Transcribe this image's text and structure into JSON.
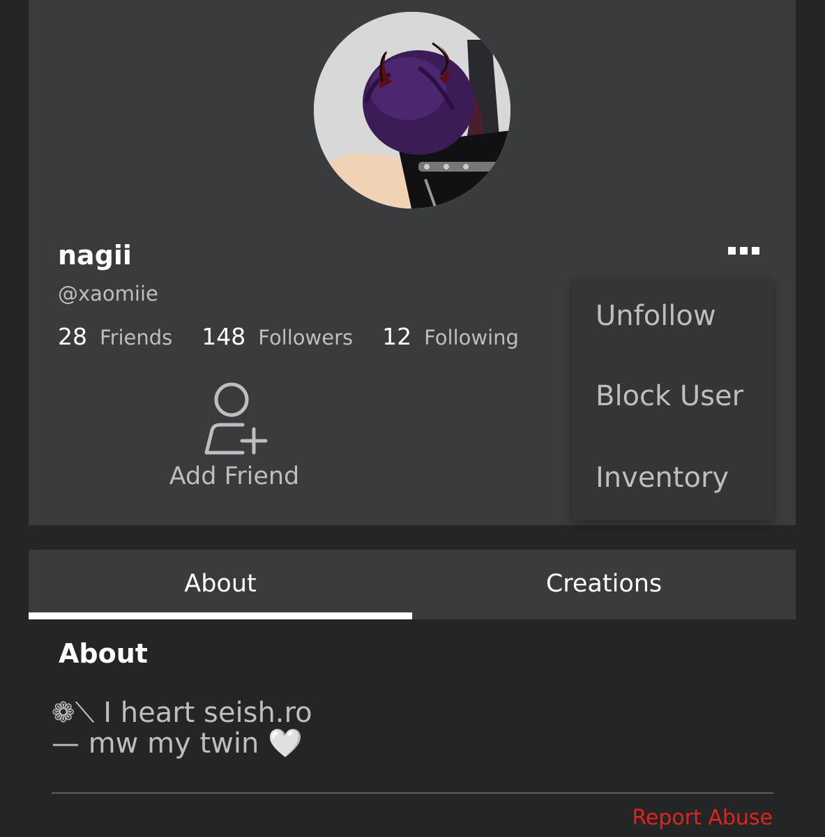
{
  "profile": {
    "display_name": "nagii",
    "username": "@xaomiie",
    "stats": [
      {
        "count": "28",
        "label": "Friends"
      },
      {
        "count": "148",
        "label": "Followers"
      },
      {
        "count": "12",
        "label": "Following"
      }
    ],
    "add_friend_label": "Add Friend",
    "avatar_icon": "avatar-headshot"
  },
  "menu": {
    "more_icon": "more-options-icon",
    "items": [
      "Unfollow",
      "Block User",
      "Inventory"
    ]
  },
  "tabs": [
    {
      "label": "About",
      "active": true
    },
    {
      "label": "Creations",
      "active": false
    }
  ],
  "about": {
    "heading": "About",
    "text": "❁⟍ I heart seish.ro\n— mw my twin 🤍"
  },
  "footer": {
    "report_label": "Report Abuse"
  },
  "colors": {
    "page_background": "#232527",
    "card_background": "#393b3d",
    "muted_text": "#bdbebe",
    "report_red": "#e2231a"
  }
}
